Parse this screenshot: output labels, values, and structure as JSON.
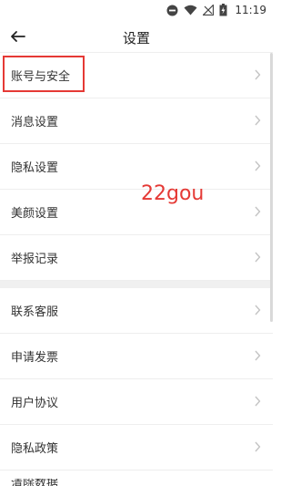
{
  "status_bar": {
    "time": "11:19",
    "icons": [
      "do-not-disturb-icon",
      "wifi-icon",
      "no-signal-icon",
      "battery-icon"
    ]
  },
  "header": {
    "title": "设置",
    "back_icon": "back-arrow-icon"
  },
  "section1": [
    {
      "label": "账号与安全",
      "name": "row-account-security"
    },
    {
      "label": "消息设置",
      "name": "row-message-settings"
    },
    {
      "label": "隐私设置",
      "name": "row-privacy-settings"
    },
    {
      "label": "美颜设置",
      "name": "row-beauty-settings"
    },
    {
      "label": "举报记录",
      "name": "row-report-records"
    }
  ],
  "section2": [
    {
      "label": "联系客服",
      "name": "row-contact-service"
    },
    {
      "label": "申请发票",
      "name": "row-apply-invoice"
    },
    {
      "label": "用户协议",
      "name": "row-user-agreement"
    },
    {
      "label": "隐私政策",
      "name": "row-privacy-policy"
    }
  ],
  "partial_row_label": "清除数据",
  "watermark": "22gou",
  "colors": {
    "highlight": "#e53935",
    "divider": "#eeeeee",
    "section_gap": "#f0f0f0"
  }
}
